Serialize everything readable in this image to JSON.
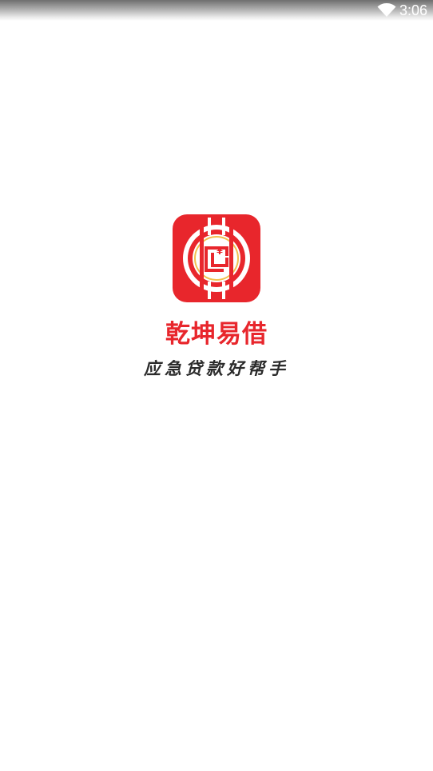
{
  "status_bar": {
    "time": "3:06",
    "wifi_icon": "wifi-icon"
  },
  "splash": {
    "logo_icon": "coin-logo-icon",
    "logo_symbol": "¥",
    "app_name": "乾坤易借",
    "slogan": "应急贷款好帮手"
  },
  "colors": {
    "brand_red": "#e8262c",
    "logo_gold": "#f2c14e",
    "slogan_text": "#2b2b2b"
  }
}
